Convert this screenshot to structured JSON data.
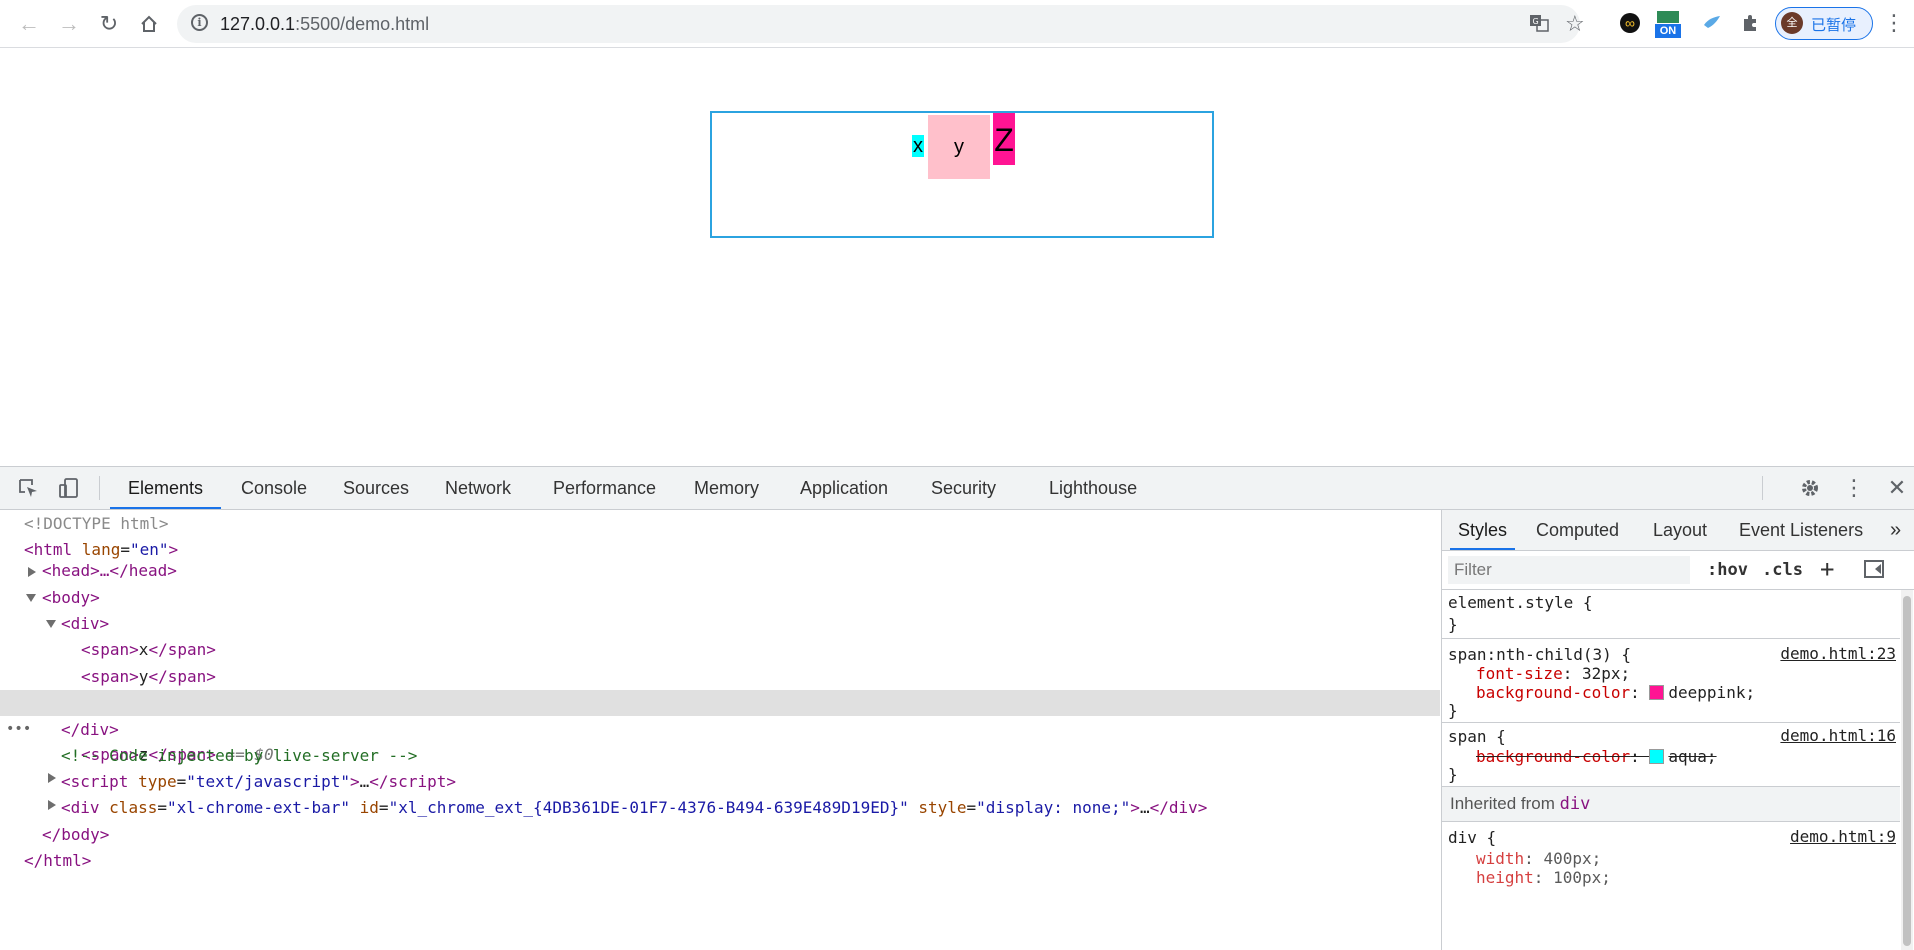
{
  "browser": {
    "url_host": "127.0.0.1",
    "url_path": ":5500/demo.html",
    "extension_on_label": "ON",
    "profile_avatar": "全",
    "profile_label": "已暂停",
    "icons": [
      "back-icon",
      "forward-icon",
      "reload-icon",
      "home-icon",
      "info-icon",
      "translate-icon",
      "star-icon",
      "extensions-icon",
      "more-icon"
    ]
  },
  "page": {
    "spans": [
      {
        "text": "x",
        "color": "#00ffff"
      },
      {
        "text": "y",
        "color": "#ffc0cb"
      },
      {
        "text": "Z",
        "color": "#ff1493"
      }
    ],
    "border_color": "#2ba3e0"
  },
  "devtools": {
    "tabs": [
      "Elements",
      "Console",
      "Sources",
      "Network",
      "Performance",
      "Memory",
      "Application",
      "Security",
      "Lighthouse"
    ],
    "active_tab": "Elements",
    "dom": {
      "doctype": "<!DOCTYPE html>",
      "html_open_tag": "<html ",
      "html_attr": "lang",
      "html_attr_val": "\"en\"",
      "head": "<head>…</head>",
      "body_open": "<body>",
      "div_open": "<div>",
      "span_x": "x",
      "span_y": "y",
      "span_z": "z",
      "selected_suffix": " == $0",
      "div_close": "</div>",
      "comment": "<!-- Code injected by live-server -->",
      "script_attr": "type",
      "script_type": "\"text/javascript\"",
      "script_collapsed": "…",
      "ext_class": "\"xl-chrome-ext-bar\"",
      "ext_id": "\"xl_chrome_ext_{4DB361DE-01F7-4376-B494-639E489D19ED}\"",
      "ext_style": "\"display: none;\"",
      "body_close": "</body>",
      "html_close": "</html>"
    },
    "styles_tabs": [
      "Styles",
      "Computed",
      "Layout",
      "Event Listeners"
    ],
    "filter_placeholder": "Filter",
    "hov": ":hov",
    "cls": ".cls",
    "rules": {
      "element_style": "element.style {",
      "close": "}",
      "nth_selector": "span:nth-child(3) {",
      "nth_src": "demo.html:23",
      "nth_font_prop": "font-size",
      "nth_font_val": "32px;",
      "nth_bg_prop": "background-color",
      "nth_bg_val": "deeppink;",
      "span_selector": "span {",
      "span_src": "demo.html:16",
      "span_bg_prop": "background-color",
      "span_bg_val": "aqua;",
      "inherited_label": "Inherited from",
      "inherited_from": "div",
      "div_selector": "div {",
      "div_src": "demo.html:9",
      "div_width_prop": "width",
      "div_width_val": "400px;",
      "div_height_prop": "height",
      "div_height_val": "100px;"
    },
    "swatches": {
      "deeppink": "#ff1493",
      "aqua": "#00ffff"
    }
  }
}
